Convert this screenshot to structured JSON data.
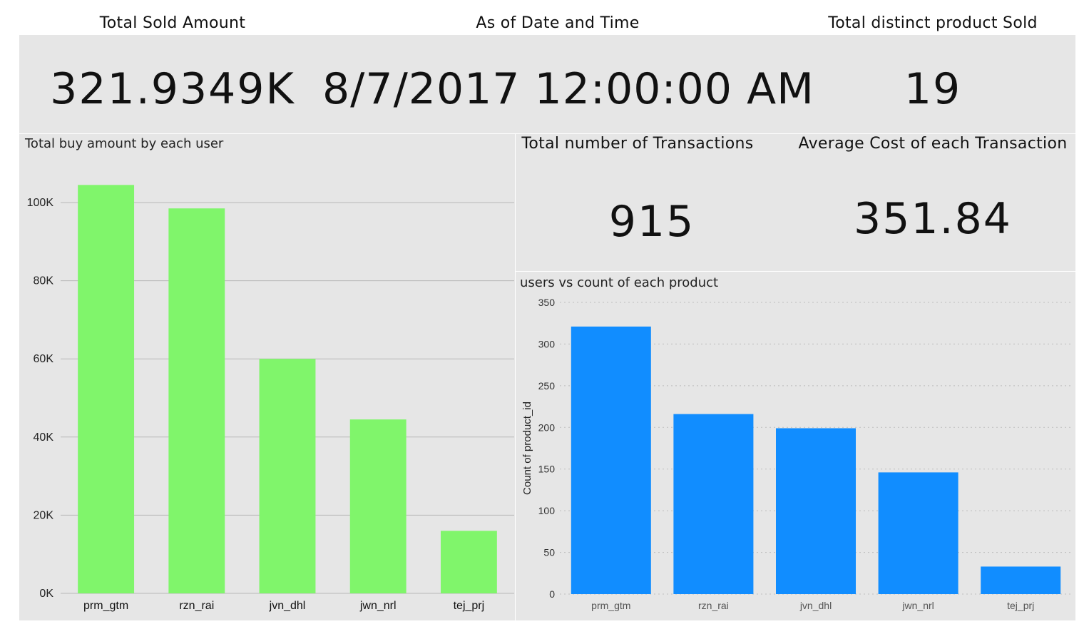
{
  "kpis": {
    "total_sold": {
      "title": "Total Sold Amount",
      "value": "321.9349K"
    },
    "as_of": {
      "title": "As of Date and Time",
      "value": "8/7/2017 12:00:00 AM"
    },
    "distinct_products": {
      "title": "Total distinct product Sold",
      "value": "19"
    },
    "transactions": {
      "title": "Total number of Transactions",
      "value": "915"
    },
    "avg_cost": {
      "title": "Average Cost of each Transaction",
      "value": "351.84"
    }
  },
  "chart_data": [
    {
      "type": "bar",
      "title": "Total buy amount by each user",
      "xlabel": "",
      "ylabel": "",
      "categories": [
        "prm_gtm",
        "rzn_rai",
        "jvn_dhl",
        "jwn_nrl",
        "tej_prj"
      ],
      "values": [
        104500,
        98500,
        60000,
        44500,
        16000
      ],
      "ylim": [
        0,
        100000
      ],
      "yticks": [
        0,
        20000,
        40000,
        60000,
        80000,
        100000
      ],
      "ytick_labels": [
        "0K",
        "20K",
        "40K",
        "60K",
        "80K",
        "100K"
      ],
      "grid": true,
      "color": "#80f56b"
    },
    {
      "type": "bar",
      "title": "users vs count of each product",
      "xlabel": "",
      "ylabel": "Count of product_id",
      "categories": [
        "prm_gtm",
        "rzn_rai",
        "jvn_dhl",
        "jwn_nrl",
        "tej_prj"
      ],
      "values": [
        321,
        216,
        199,
        146,
        33
      ],
      "ylim": [
        0,
        350
      ],
      "yticks": [
        0,
        50,
        100,
        150,
        200,
        250,
        300,
        350
      ],
      "ytick_labels": [
        "0",
        "50",
        "100",
        "150",
        "200",
        "250",
        "300",
        "350"
      ],
      "grid": true,
      "color": "#118dff"
    }
  ]
}
